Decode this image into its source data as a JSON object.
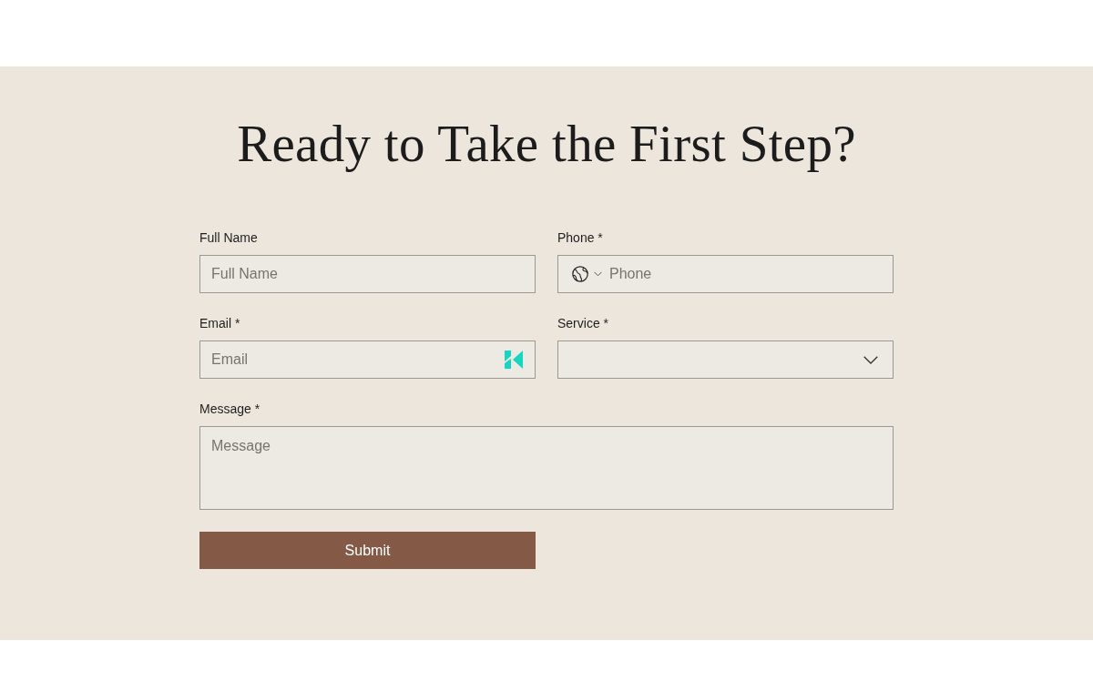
{
  "heading": "Ready to Take the First Step?",
  "fields": [
    {
      "kind": "text",
      "label": "Full Name",
      "placeholder": "Full Name"
    },
    {
      "kind": "phone",
      "label": "Phone *",
      "placeholder": "Phone"
    },
    {
      "kind": "email",
      "label": "Email *",
      "placeholder": "Email"
    },
    {
      "kind": "select",
      "label": "Service *"
    },
    {
      "kind": "textarea",
      "label": "Message *",
      "placeholder": "Message"
    }
  ],
  "submit": "Submit"
}
